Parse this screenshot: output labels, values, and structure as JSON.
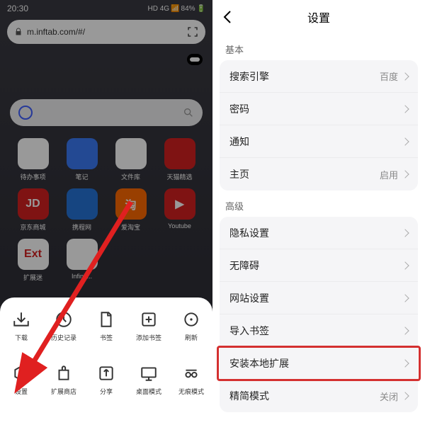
{
  "left": {
    "status": {
      "time": "20:30",
      "battery": "84%",
      "network": "HD 4G"
    },
    "address_bar": {
      "url": "m.inftab.com/#/"
    },
    "apps": {
      "row1": [
        {
          "label": "待办事项",
          "bg": "#ffffff",
          "fg": "#888",
          "txt": ""
        },
        {
          "label": "笔记",
          "bg": "#3b7af5",
          "fg": "#fff",
          "txt": ""
        },
        {
          "label": "文件库",
          "bg": "#ffffff",
          "fg": "#333",
          "txt": ""
        },
        {
          "label": "天猫精选",
          "bg": "#d42020",
          "fg": "#fff",
          "txt": ""
        }
      ],
      "row2": [
        {
          "label": "京东商城",
          "bg": "#d42020",
          "fg": "#fff",
          "txt": "JD"
        },
        {
          "label": "携程网",
          "bg": "#2573d8",
          "fg": "#fff",
          "txt": ""
        },
        {
          "label": "爱淘宝",
          "bg": "#ff6a00",
          "fg": "#fff",
          "txt": "淘"
        },
        {
          "label": "Youtube",
          "bg": "#d42020",
          "fg": "#fff",
          "txt": "▶"
        }
      ],
      "row3": [
        {
          "label": "扩展迷",
          "bg": "#ffffff",
          "fg": "#d42020",
          "txt": "Ext"
        },
        {
          "label": "Infinit...",
          "bg": "#ffffff",
          "fg": "#555",
          "txt": ""
        },
        {
          "label": "",
          "bg": "transparent",
          "fg": "",
          "txt": ""
        },
        {
          "label": "",
          "bg": "transparent",
          "fg": "",
          "txt": ""
        }
      ]
    },
    "sheet": {
      "row1": [
        {
          "label": "下载",
          "icon": "download"
        },
        {
          "label": "历史记录",
          "icon": "history"
        },
        {
          "label": "书签",
          "icon": "bookmark"
        },
        {
          "label": "添加书签",
          "icon": "add-bookmark"
        },
        {
          "label": "刷新",
          "icon": "refresh"
        }
      ],
      "row2": [
        {
          "label": "设置",
          "icon": "settings"
        },
        {
          "label": "扩展商店",
          "icon": "extension"
        },
        {
          "label": "分享",
          "icon": "share"
        },
        {
          "label": "桌面模式",
          "icon": "desktop"
        },
        {
          "label": "无痕模式",
          "icon": "incognito"
        }
      ]
    }
  },
  "right": {
    "header": {
      "title": "设置"
    },
    "sections": {
      "basic": {
        "title": "基本",
        "rows": [
          {
            "label": "搜索引擎",
            "value": "百度"
          },
          {
            "label": "密码",
            "value": ""
          },
          {
            "label": "通知",
            "value": ""
          },
          {
            "label": "主页",
            "value": "启用"
          }
        ]
      },
      "advanced": {
        "title": "高级",
        "rows": [
          {
            "label": "隐私设置",
            "value": ""
          },
          {
            "label": "无障碍",
            "value": ""
          },
          {
            "label": "网站设置",
            "value": ""
          },
          {
            "label": "导入书签",
            "value": ""
          },
          {
            "label": "安装本地扩展",
            "value": ""
          },
          {
            "label": "精简模式",
            "value": "关闭"
          }
        ]
      }
    },
    "highlight_row_index": 4
  }
}
